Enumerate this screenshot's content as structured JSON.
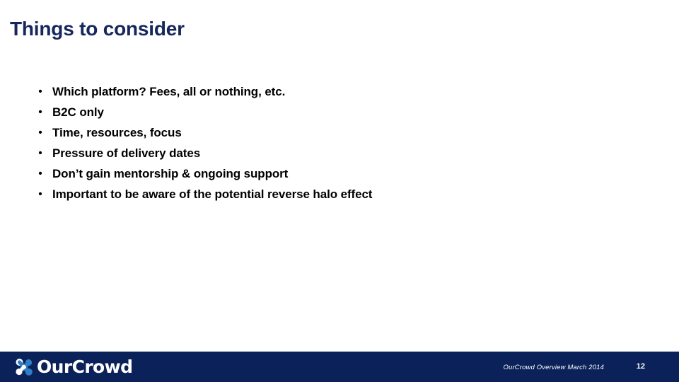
{
  "slide": {
    "title": "Things to consider",
    "title_color": "#16275c",
    "background_color": "#ffffff",
    "bullet_marker": "•",
    "bullets": [
      {
        "text": "Which platform? Fees, all or nothing, etc."
      },
      {
        "text": "B2C only"
      },
      {
        "text": "Time, resources, focus"
      },
      {
        "text": "Pressure of delivery dates"
      },
      {
        "text": "Don’t gain mentorship & ongoing support"
      },
      {
        "text": "Important to be aware of the potential reverse halo effect"
      }
    ]
  },
  "footer": {
    "background_color": "#0a2259",
    "logo_wordmark": "OurCrowd",
    "logo_mark_name": "ourcrowd-logo-mark",
    "logo_mark_color_primary": "#ffffff",
    "logo_mark_color_secondary": "#2f7fc6",
    "note": "OurCrowd Overview March 2014",
    "page_number": "12"
  }
}
